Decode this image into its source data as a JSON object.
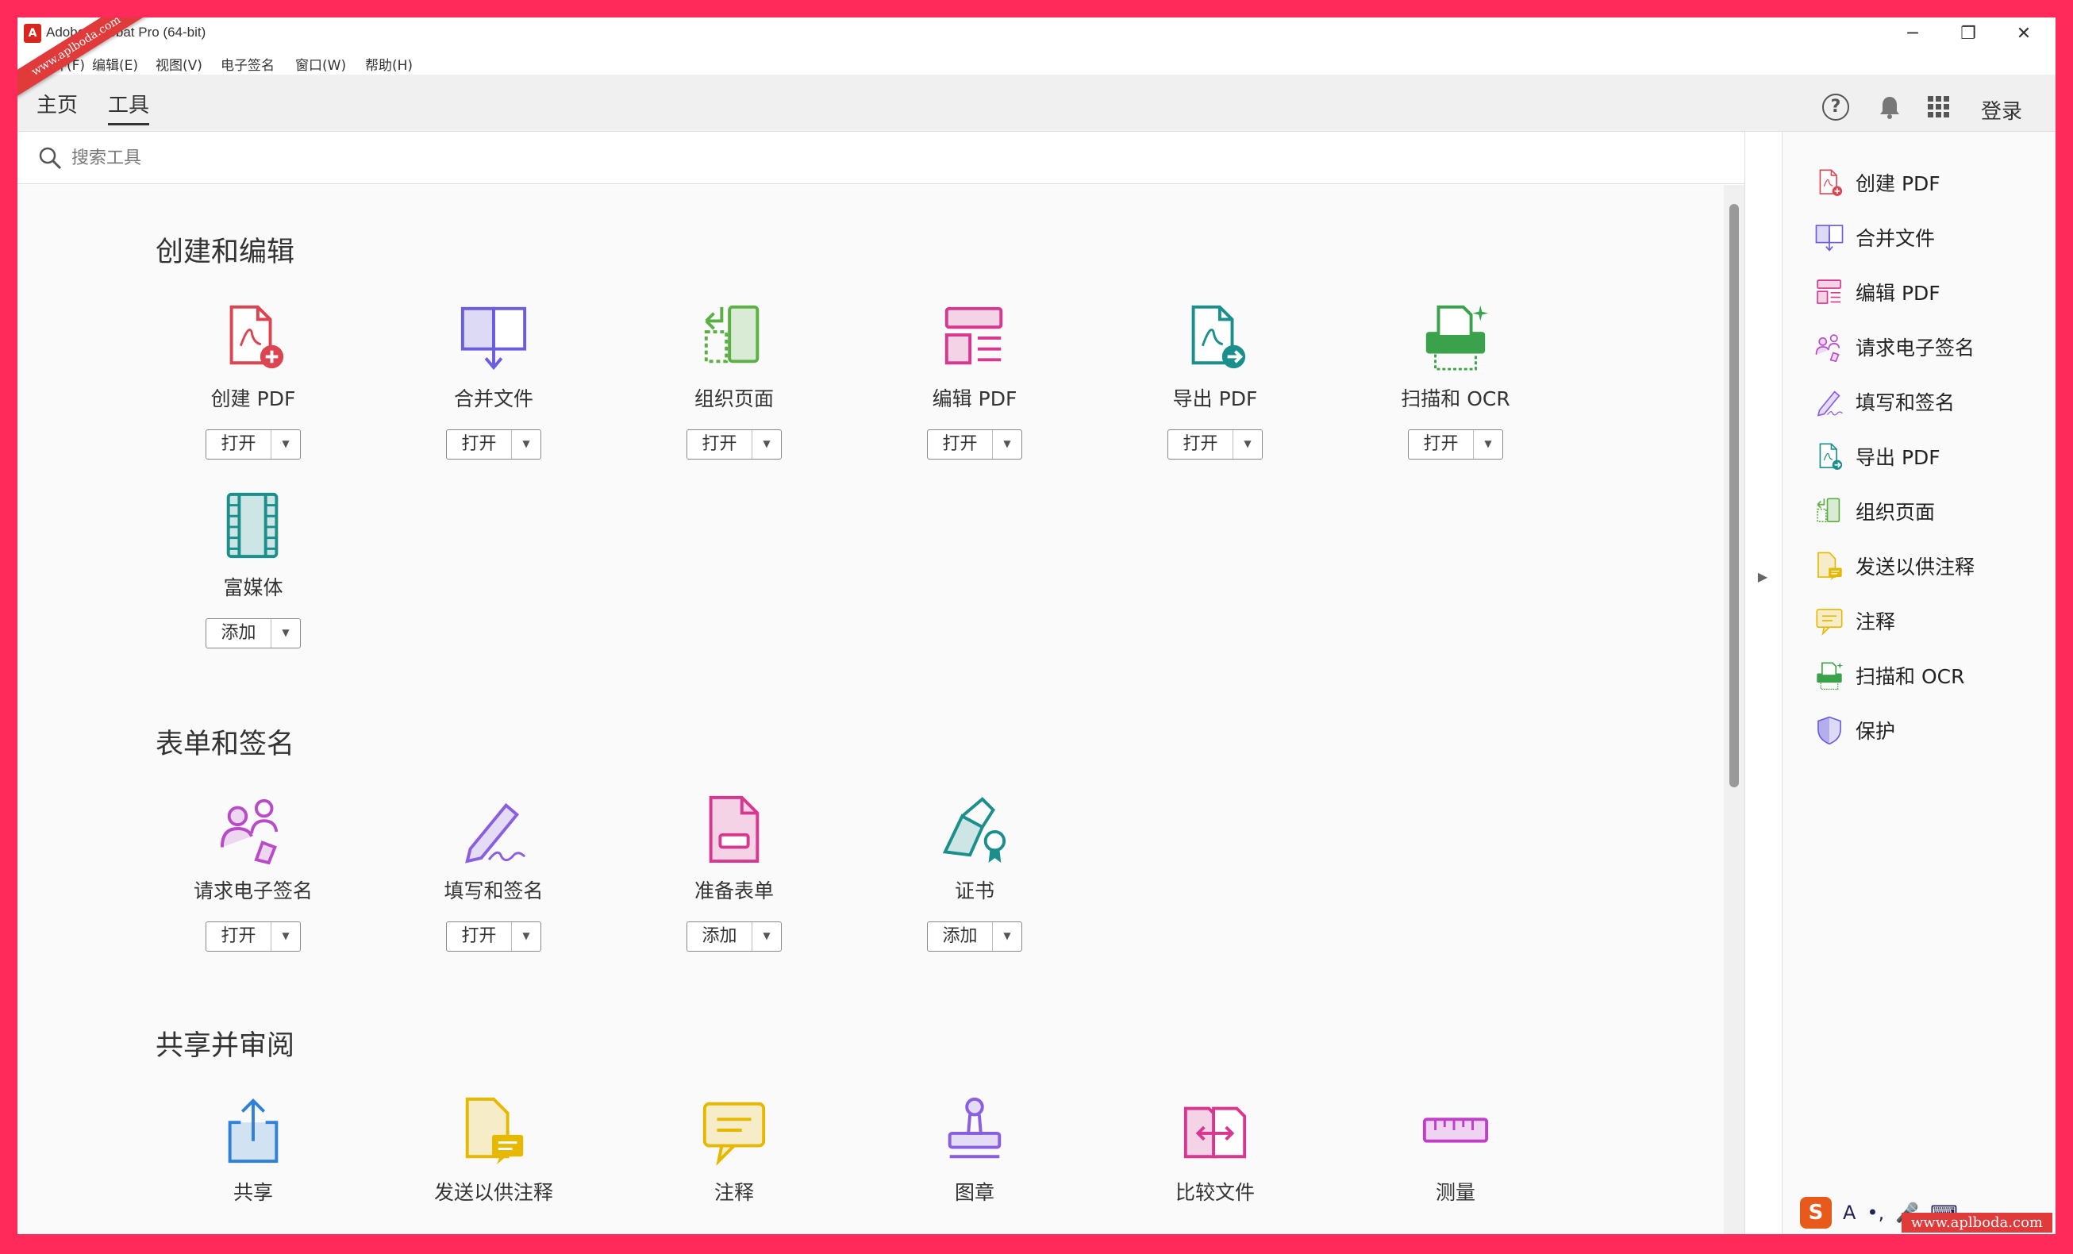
{
  "window": {
    "title": "Adobe Acrobat Pro (64-bit)",
    "logo_glyph": "A",
    "minimize": "─",
    "restore": "❐",
    "close": "✕"
  },
  "watermark": {
    "top": "www.aplboda.com",
    "bottom": "www.aplboda.com"
  },
  "menu": [
    "文件(F)",
    "编辑(E)",
    "视图(V)",
    "电子签名",
    "窗口(W)",
    "帮助(H)"
  ],
  "tabs": {
    "home": "主页",
    "tools": "工具",
    "active": "tools"
  },
  "top_right": {
    "help_glyph": "?",
    "login": "登录"
  },
  "search": {
    "placeholder": "搜索工具",
    "value": ""
  },
  "sections": [
    {
      "title": "创建和编辑",
      "tools": [
        {
          "label": "创建 PDF",
          "button": "打开",
          "icon": "create-pdf-icon",
          "color": "#dd4451"
        },
        {
          "label": "合并文件",
          "button": "打开",
          "icon": "combine-files-icon",
          "color": "#6b5ce0"
        },
        {
          "label": "组织页面",
          "button": "打开",
          "icon": "organize-pages-icon",
          "color": "#5bb043"
        },
        {
          "label": "编辑 PDF",
          "button": "打开",
          "icon": "edit-pdf-icon",
          "color": "#d83790"
        },
        {
          "label": "导出 PDF",
          "button": "打开",
          "icon": "export-pdf-icon",
          "color": "#1a8f8c"
        },
        {
          "label": "扫描和 OCR",
          "button": "打开",
          "icon": "scan-ocr-icon",
          "color": "#3aa24a"
        },
        {
          "label": "富媒体",
          "button": "添加",
          "icon": "rich-media-icon",
          "color": "#1a8f8c"
        }
      ]
    },
    {
      "title": "表单和签名",
      "tools": [
        {
          "label": "请求电子签名",
          "button": "打开",
          "icon": "request-esign-icon",
          "color": "#b94ac8"
        },
        {
          "label": "填写和签名",
          "button": "打开",
          "icon": "fill-sign-icon",
          "color": "#8a5ee0"
        },
        {
          "label": "准备表单",
          "button": "添加",
          "icon": "prepare-form-icon",
          "color": "#d83790"
        },
        {
          "label": "证书",
          "button": "添加",
          "icon": "certificate-icon",
          "color": "#1a8f8c"
        }
      ]
    },
    {
      "title": "共享并审阅",
      "tools": [
        {
          "label": "共享",
          "icon": "share-icon",
          "color": "#2f80d8"
        },
        {
          "label": "发送以供注释",
          "icon": "send-for-comments-icon",
          "color": "#e6b800"
        },
        {
          "label": "注释",
          "icon": "comment-icon",
          "color": "#e6b800"
        },
        {
          "label": "图章",
          "icon": "stamp-icon",
          "color": "#8a5ee0"
        },
        {
          "label": "比较文件",
          "icon": "compare-files-icon",
          "color": "#d83790"
        },
        {
          "label": "测量",
          "icon": "measure-icon",
          "color": "#c03ec8"
        }
      ]
    }
  ],
  "right_panel": [
    {
      "label": "创建 PDF",
      "icon": "create-pdf-icon",
      "color": "#dd4451"
    },
    {
      "label": "合并文件",
      "icon": "combine-files-icon",
      "color": "#6b5ce0"
    },
    {
      "label": "编辑 PDF",
      "icon": "edit-pdf-icon",
      "color": "#d83790"
    },
    {
      "label": "请求电子签名",
      "icon": "request-esign-icon",
      "color": "#b94ac8"
    },
    {
      "label": "填写和签名",
      "icon": "fill-sign-icon",
      "color": "#8a5ee0"
    },
    {
      "label": "导出 PDF",
      "icon": "export-pdf-icon",
      "color": "#1a8f8c"
    },
    {
      "label": "组织页面",
      "icon": "organize-pages-icon",
      "color": "#5bb043"
    },
    {
      "label": "发送以供注释",
      "icon": "send-for-comments-icon",
      "color": "#e6b800"
    },
    {
      "label": "注释",
      "icon": "comment-icon",
      "color": "#e6b800"
    },
    {
      "label": "扫描和 OCR",
      "icon": "scan-ocr-icon",
      "color": "#3aa24a"
    },
    {
      "label": "保护",
      "icon": "protect-icon",
      "color": "#6b5ce0"
    }
  ],
  "tray": {
    "ime": "S",
    "lang": "A"
  }
}
